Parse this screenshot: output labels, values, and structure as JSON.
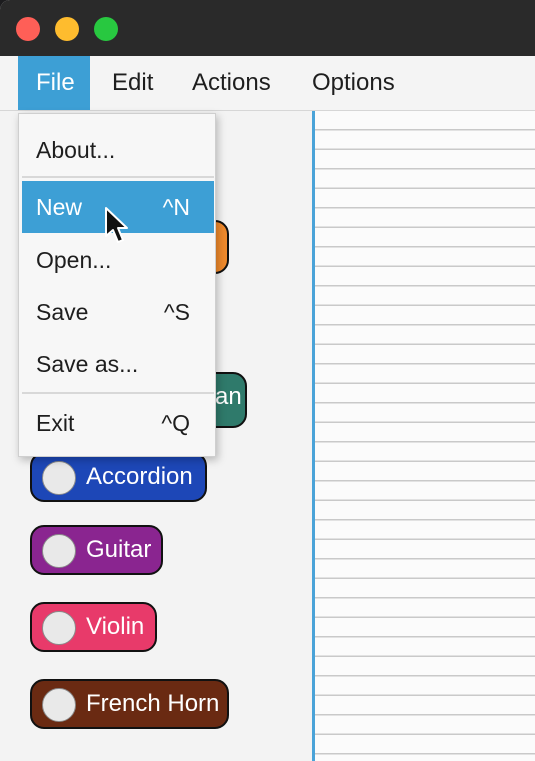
{
  "menubar": {
    "items": [
      {
        "label": "File"
      },
      {
        "label": "Edit"
      },
      {
        "label": "Actions"
      },
      {
        "label": "Options"
      }
    ]
  },
  "file_menu": {
    "items": [
      {
        "label": "About...",
        "shortcut": ""
      },
      {
        "label": "New",
        "shortcut": "^N"
      },
      {
        "label": "Open...",
        "shortcut": ""
      },
      {
        "label": "Save",
        "shortcut": "^S"
      },
      {
        "label": "Save as...",
        "shortcut": ""
      },
      {
        "label": "Exit",
        "shortcut": "^Q"
      }
    ]
  },
  "instruments": {
    "partial_teal": "an",
    "items": [
      {
        "label": "Accordion",
        "color": "#1d47b7"
      },
      {
        "label": "Guitar",
        "color": "#8a2590"
      },
      {
        "label": "Violin",
        "color": "#e83a6a"
      },
      {
        "label": "French Horn",
        "color": "#6a2a12"
      }
    ],
    "hidden_colors": {
      "orange": "#f08a2c",
      "teal": "#2f7a6b"
    }
  },
  "colors": {
    "accent": "#3d9fd5",
    "grid_border": "#4aa3d8"
  }
}
